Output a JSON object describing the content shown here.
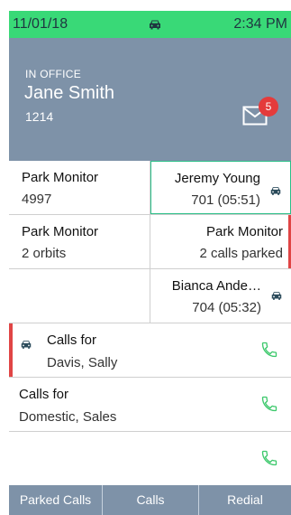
{
  "status_bar": {
    "date": "11/01/18",
    "time": "2:34 PM",
    "center_icon": "car-icon"
  },
  "header": {
    "presence": "IN OFFICE",
    "name": "Jane Smith",
    "extension": "1214",
    "voicemail_count": "5",
    "voicemail_icon": "envelope-icon"
  },
  "keys": {
    "row1": {
      "left": {
        "title": "Park Monitor",
        "subtitle": "4997"
      },
      "right": {
        "title": "Jeremy Young",
        "subtitle": "701 (05:51)",
        "icon": "car-icon"
      }
    },
    "row2": {
      "left": {
        "title": "Park Monitor",
        "subtitle": "2 orbits"
      },
      "right": {
        "title": "Park Monitor",
        "subtitle": "2 calls parked"
      }
    },
    "row3": {
      "right": {
        "title": "Bianca Ande…",
        "subtitle": "704 (05:32)",
        "icon": "car-icon"
      }
    },
    "row4": {
      "title": "Calls for",
      "subtitle": "Davis, Sally",
      "left_icon": "car-icon",
      "right_icon": "phone-icon"
    },
    "row5": {
      "title": "Calls for",
      "subtitle": "Domestic, Sales",
      "right_icon": "phone-icon"
    },
    "row6": {
      "right_icon": "phone-icon"
    }
  },
  "softkeys": [
    "Parked Calls",
    "Calls",
    "Redial"
  ],
  "colors": {
    "status_bar": "#39d977",
    "header": "#7e92a8",
    "badge": "#e43b3b",
    "accent_green": "#2bbf88",
    "alert_red": "#e04545",
    "phone_green": "#3cc86b"
  }
}
